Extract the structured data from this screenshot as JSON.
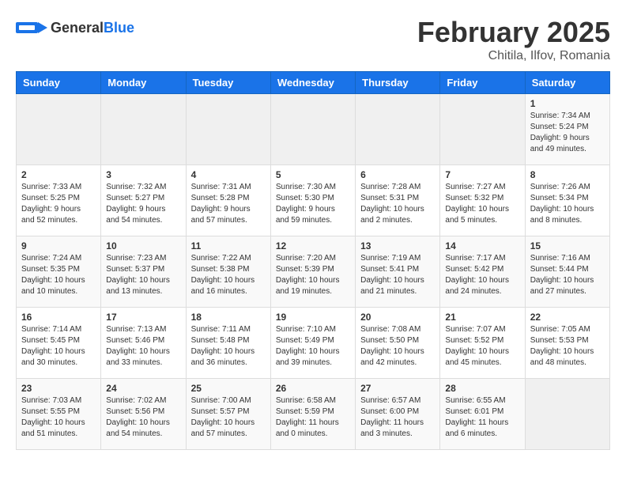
{
  "header": {
    "logo_general": "General",
    "logo_blue": "Blue",
    "title": "February 2025",
    "subtitle": "Chitila, Ilfov, Romania"
  },
  "days_of_week": [
    "Sunday",
    "Monday",
    "Tuesday",
    "Wednesday",
    "Thursday",
    "Friday",
    "Saturday"
  ],
  "weeks": [
    [
      {
        "day": "",
        "info": ""
      },
      {
        "day": "",
        "info": ""
      },
      {
        "day": "",
        "info": ""
      },
      {
        "day": "",
        "info": ""
      },
      {
        "day": "",
        "info": ""
      },
      {
        "day": "",
        "info": ""
      },
      {
        "day": "1",
        "info": "Sunrise: 7:34 AM\nSunset: 5:24 PM\nDaylight: 9 hours\nand 49 minutes."
      }
    ],
    [
      {
        "day": "2",
        "info": "Sunrise: 7:33 AM\nSunset: 5:25 PM\nDaylight: 9 hours\nand 52 minutes."
      },
      {
        "day": "3",
        "info": "Sunrise: 7:32 AM\nSunset: 5:27 PM\nDaylight: 9 hours\nand 54 minutes."
      },
      {
        "day": "4",
        "info": "Sunrise: 7:31 AM\nSunset: 5:28 PM\nDaylight: 9 hours\nand 57 minutes."
      },
      {
        "day": "5",
        "info": "Sunrise: 7:30 AM\nSunset: 5:30 PM\nDaylight: 9 hours\nand 59 minutes."
      },
      {
        "day": "6",
        "info": "Sunrise: 7:28 AM\nSunset: 5:31 PM\nDaylight: 10 hours\nand 2 minutes."
      },
      {
        "day": "7",
        "info": "Sunrise: 7:27 AM\nSunset: 5:32 PM\nDaylight: 10 hours\nand 5 minutes."
      },
      {
        "day": "8",
        "info": "Sunrise: 7:26 AM\nSunset: 5:34 PM\nDaylight: 10 hours\nand 8 minutes."
      }
    ],
    [
      {
        "day": "9",
        "info": "Sunrise: 7:24 AM\nSunset: 5:35 PM\nDaylight: 10 hours\nand 10 minutes."
      },
      {
        "day": "10",
        "info": "Sunrise: 7:23 AM\nSunset: 5:37 PM\nDaylight: 10 hours\nand 13 minutes."
      },
      {
        "day": "11",
        "info": "Sunrise: 7:22 AM\nSunset: 5:38 PM\nDaylight: 10 hours\nand 16 minutes."
      },
      {
        "day": "12",
        "info": "Sunrise: 7:20 AM\nSunset: 5:39 PM\nDaylight: 10 hours\nand 19 minutes."
      },
      {
        "day": "13",
        "info": "Sunrise: 7:19 AM\nSunset: 5:41 PM\nDaylight: 10 hours\nand 21 minutes."
      },
      {
        "day": "14",
        "info": "Sunrise: 7:17 AM\nSunset: 5:42 PM\nDaylight: 10 hours\nand 24 minutes."
      },
      {
        "day": "15",
        "info": "Sunrise: 7:16 AM\nSunset: 5:44 PM\nDaylight: 10 hours\nand 27 minutes."
      }
    ],
    [
      {
        "day": "16",
        "info": "Sunrise: 7:14 AM\nSunset: 5:45 PM\nDaylight: 10 hours\nand 30 minutes."
      },
      {
        "day": "17",
        "info": "Sunrise: 7:13 AM\nSunset: 5:46 PM\nDaylight: 10 hours\nand 33 minutes."
      },
      {
        "day": "18",
        "info": "Sunrise: 7:11 AM\nSunset: 5:48 PM\nDaylight: 10 hours\nand 36 minutes."
      },
      {
        "day": "19",
        "info": "Sunrise: 7:10 AM\nSunset: 5:49 PM\nDaylight: 10 hours\nand 39 minutes."
      },
      {
        "day": "20",
        "info": "Sunrise: 7:08 AM\nSunset: 5:50 PM\nDaylight: 10 hours\nand 42 minutes."
      },
      {
        "day": "21",
        "info": "Sunrise: 7:07 AM\nSunset: 5:52 PM\nDaylight: 10 hours\nand 45 minutes."
      },
      {
        "day": "22",
        "info": "Sunrise: 7:05 AM\nSunset: 5:53 PM\nDaylight: 10 hours\nand 48 minutes."
      }
    ],
    [
      {
        "day": "23",
        "info": "Sunrise: 7:03 AM\nSunset: 5:55 PM\nDaylight: 10 hours\nand 51 minutes."
      },
      {
        "day": "24",
        "info": "Sunrise: 7:02 AM\nSunset: 5:56 PM\nDaylight: 10 hours\nand 54 minutes."
      },
      {
        "day": "25",
        "info": "Sunrise: 7:00 AM\nSunset: 5:57 PM\nDaylight: 10 hours\nand 57 minutes."
      },
      {
        "day": "26",
        "info": "Sunrise: 6:58 AM\nSunset: 5:59 PM\nDaylight: 11 hours\nand 0 minutes."
      },
      {
        "day": "27",
        "info": "Sunrise: 6:57 AM\nSunset: 6:00 PM\nDaylight: 11 hours\nand 3 minutes."
      },
      {
        "day": "28",
        "info": "Sunrise: 6:55 AM\nSunset: 6:01 PM\nDaylight: 11 hours\nand 6 minutes."
      },
      {
        "day": "",
        "info": ""
      }
    ]
  ]
}
